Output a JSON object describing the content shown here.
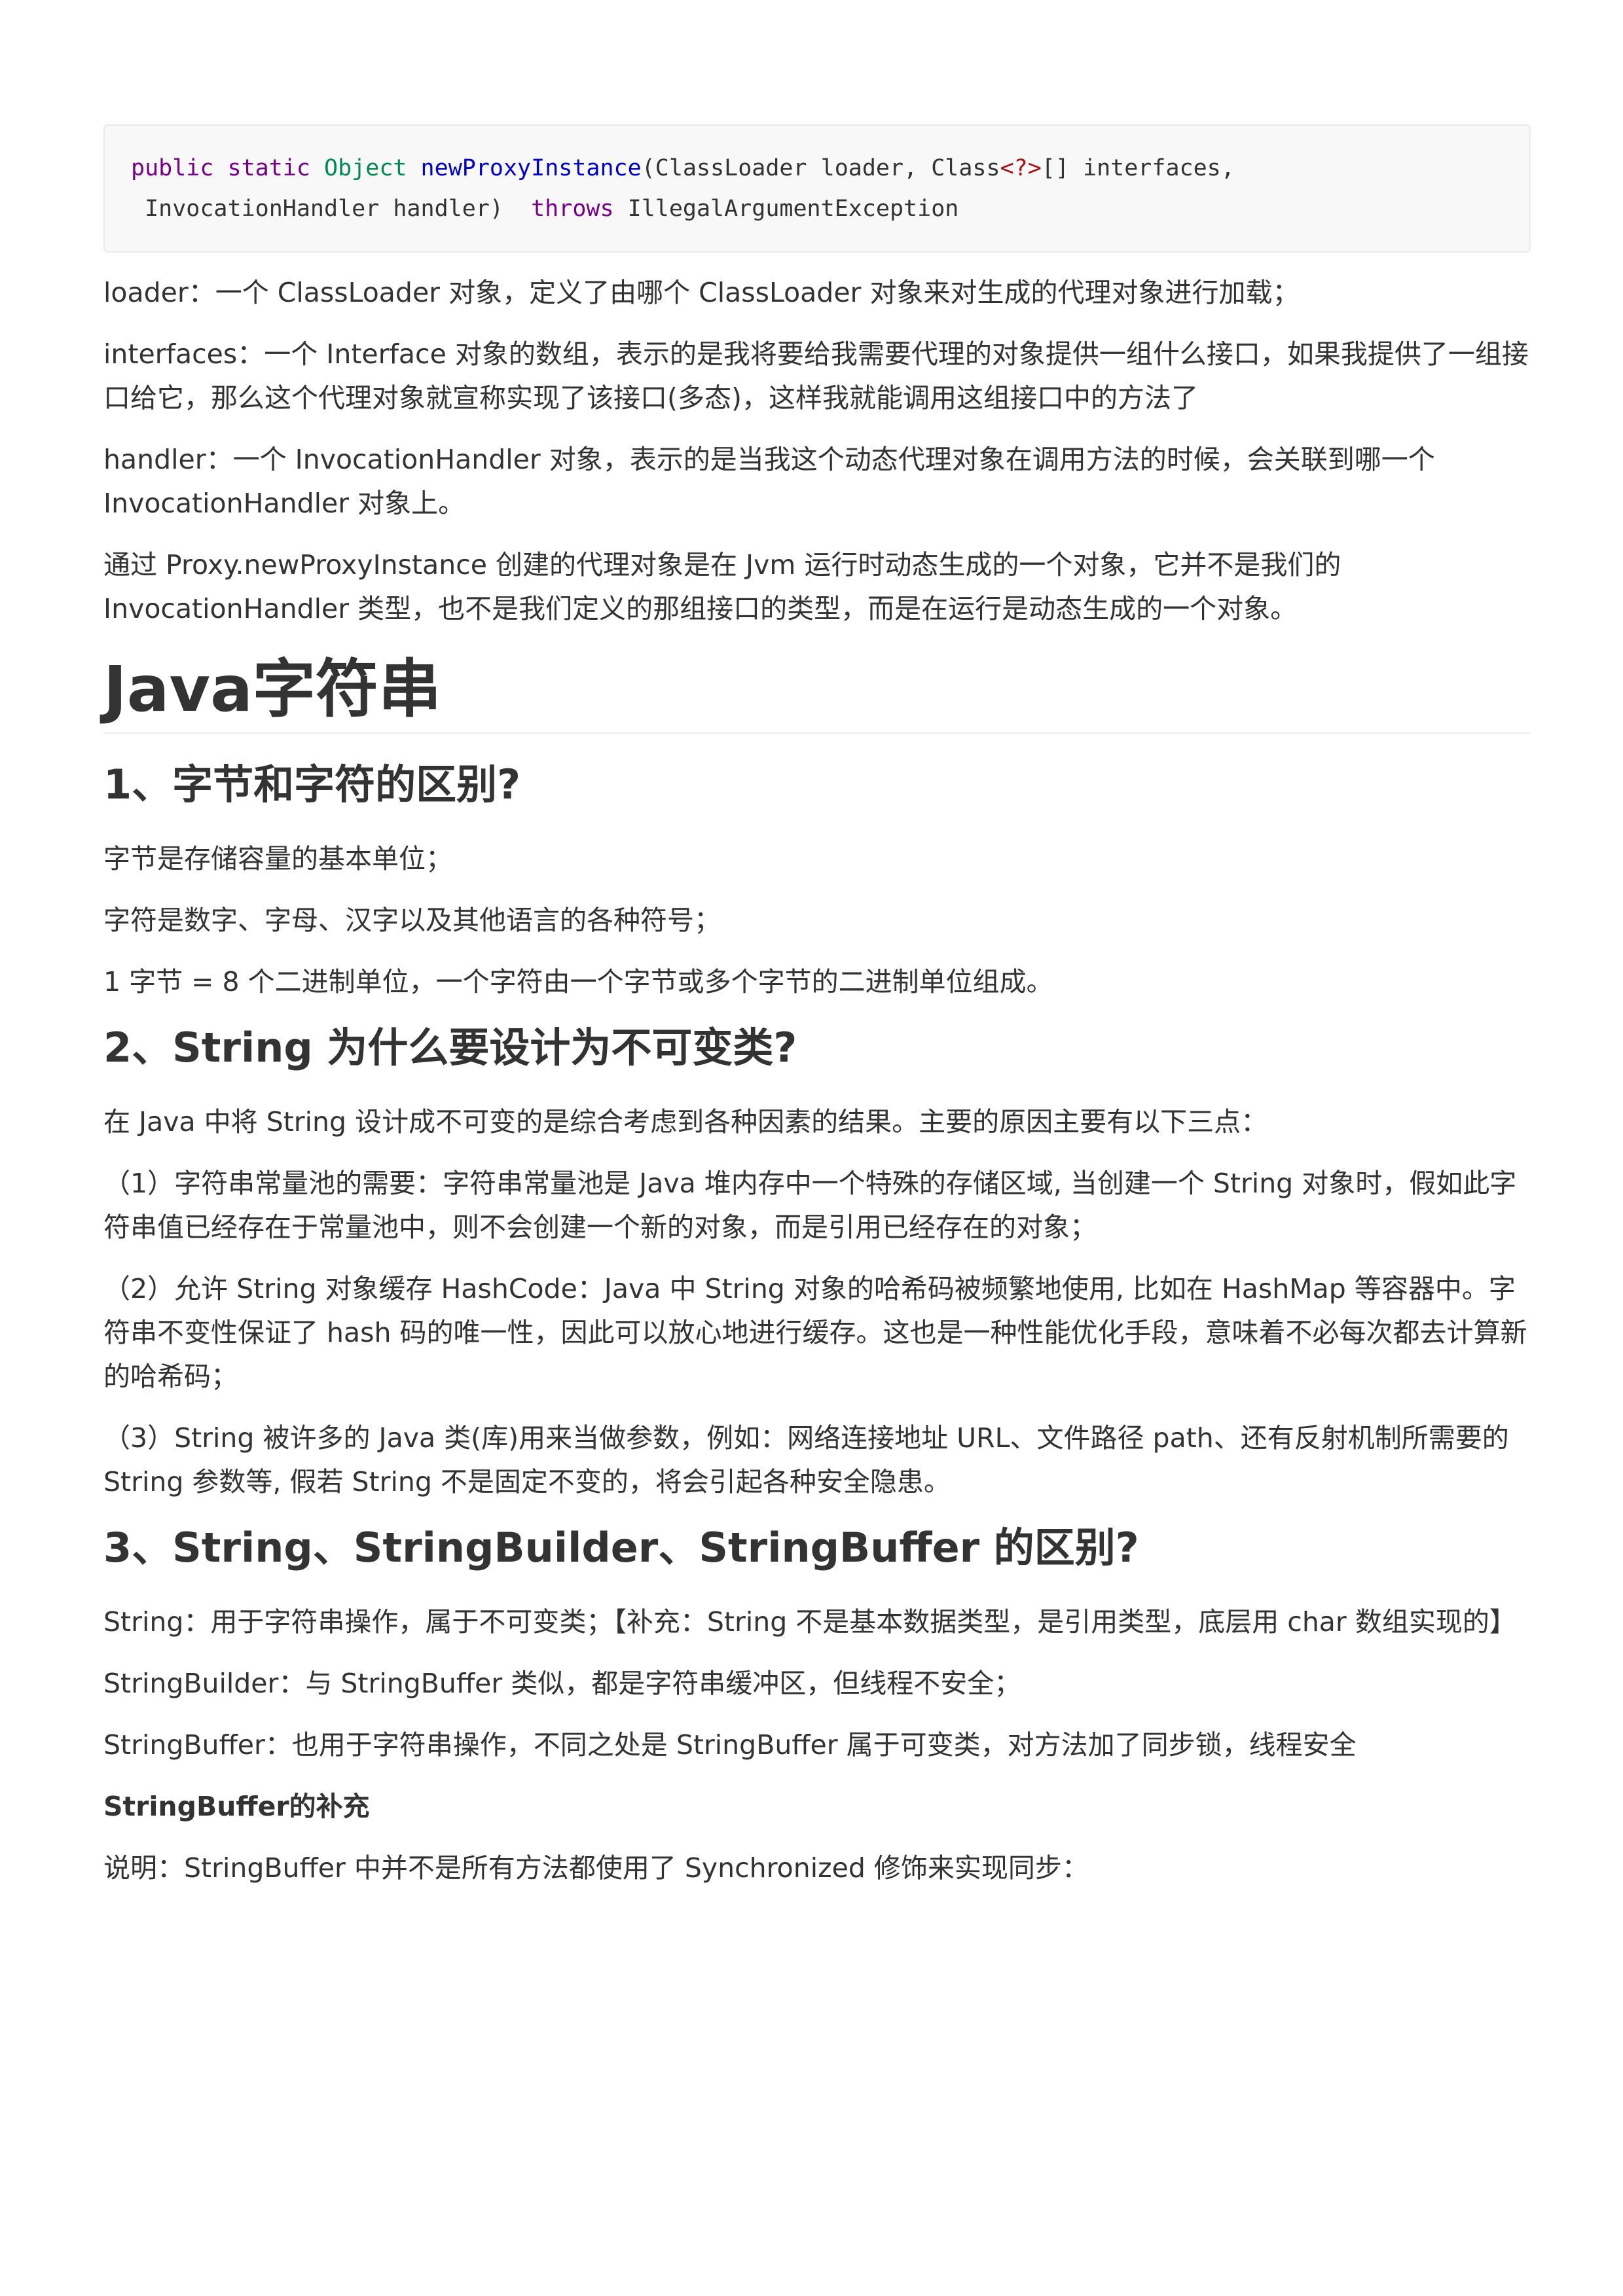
{
  "code": {
    "line1": {
      "kw1": "public",
      "kw2": "static",
      "type": "Object",
      "method": "newProxyInstance",
      "params_a": "(ClassLoader loader, Class",
      "generic": "<?>",
      "params_b": "[] interfaces,"
    },
    "line2": {
      "params": " InvocationHandler handler)",
      "kw": "throws",
      "exception": "IllegalArgumentException"
    }
  },
  "intro_paragraphs": [
    "loader：一个 ClassLoader 对象，定义了由哪个 ClassLoader 对象来对生成的代理对象进行加载；",
    "interfaces：一个 Interface 对象的数组，表示的是我将要给我需要代理的对象提供一组什么接口，如果我提供了一组接口给它，那么这个代理对象就宣称实现了该接口(多态)，这样我就能调用这组接口中的方法了",
    "handler：一个 InvocationHandler 对象，表示的是当我这个动态代理对象在调用方法的时候，会关联到哪一个 InvocationHandler 对象上。",
    "通过 Proxy.newProxyInstance 创建的代理对象是在 Jvm 运行时动态生成的一个对象，它并不是我们的 InvocationHandler 类型，也不是我们定义的那组接口的类型，而是在运行是动态生成的一个对象。"
  ],
  "section_title": "Java字符串",
  "q1": {
    "heading": "1、字节和字符的区别?",
    "paragraphs": [
      "字节是存储容量的基本单位；",
      "字符是数字、字母、汉字以及其他语言的各种符号；",
      "1 字节 = 8 个二进制单位，一个字符由一个字节或多个字节的二进制单位组成。"
    ]
  },
  "q2": {
    "heading": "2、String 为什么要设计为不可变类?",
    "paragraphs": [
      "在 Java 中将 String 设计成不可变的是综合考虑到各种因素的结果。主要的原因主要有以下三点：",
      "（1）字符串常量池的需要：字符串常量池是 Java 堆内存中一个特殊的存储区域, 当创建一个 String 对象时，假如此字符串值已经存在于常量池中，则不会创建一个新的对象，而是引用已经存在的对象；",
      "（2）允许 String 对象缓存 HashCode：Java 中 String 对象的哈希码被频繁地使用, 比如在 HashMap 等容器中。字符串不变性保证了 hash 码的唯一性，因此可以放心地进行缓存。这也是一种性能优化手段，意味着不必每次都去计算新的哈希码；",
      "（3）String 被许多的 Java 类(库)用来当做参数，例如：网络连接地址 URL、文件路径 path、还有反射机制所需要的 String 参数等, 假若 String 不是固定不变的，将会引起各种安全隐患。"
    ]
  },
  "q3": {
    "heading": "3、String、StringBuilder、StringBuffer 的区别?",
    "paragraphs": [
      "String：用于字符串操作，属于不可变类；【补充：String 不是基本数据类型，是引用类型，底层用 char 数组实现的】",
      "StringBuilder：与 StringBuffer 类似，都是字符串缓冲区，但线程不安全；",
      "StringBuffer：也用于字符串操作，不同之处是 StringBuffer 属于可变类，对方法加了同步锁，线程安全"
    ],
    "bold_note": "StringBuffer的补充",
    "explanation": "说明：StringBuffer 中并不是所有方法都使用了 Synchronized 修饰来实现同步："
  }
}
